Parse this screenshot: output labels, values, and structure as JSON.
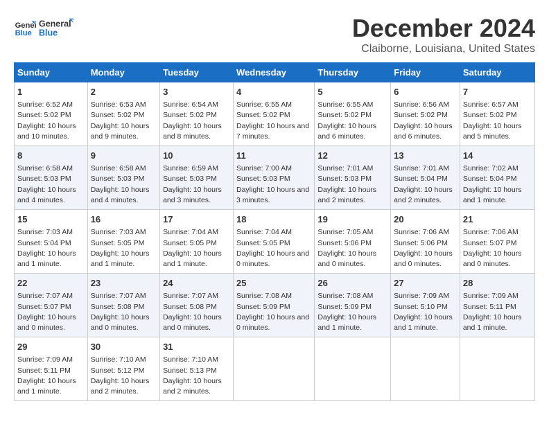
{
  "logo": {
    "line1": "General",
    "line2": "Blue"
  },
  "title": "December 2024",
  "subtitle": "Claiborne, Louisiana, United States",
  "days_of_week": [
    "Sunday",
    "Monday",
    "Tuesday",
    "Wednesday",
    "Thursday",
    "Friday",
    "Saturday"
  ],
  "weeks": [
    [
      {
        "day": "1",
        "info": "Sunrise: 6:52 AM\nSunset: 5:02 PM\nDaylight: 10 hours and 10 minutes."
      },
      {
        "day": "2",
        "info": "Sunrise: 6:53 AM\nSunset: 5:02 PM\nDaylight: 10 hours and 9 minutes."
      },
      {
        "day": "3",
        "info": "Sunrise: 6:54 AM\nSunset: 5:02 PM\nDaylight: 10 hours and 8 minutes."
      },
      {
        "day": "4",
        "info": "Sunrise: 6:55 AM\nSunset: 5:02 PM\nDaylight: 10 hours and 7 minutes."
      },
      {
        "day": "5",
        "info": "Sunrise: 6:55 AM\nSunset: 5:02 PM\nDaylight: 10 hours and 6 minutes."
      },
      {
        "day": "6",
        "info": "Sunrise: 6:56 AM\nSunset: 5:02 PM\nDaylight: 10 hours and 6 minutes."
      },
      {
        "day": "7",
        "info": "Sunrise: 6:57 AM\nSunset: 5:02 PM\nDaylight: 10 hours and 5 minutes."
      }
    ],
    [
      {
        "day": "8",
        "info": "Sunrise: 6:58 AM\nSunset: 5:03 PM\nDaylight: 10 hours and 4 minutes."
      },
      {
        "day": "9",
        "info": "Sunrise: 6:58 AM\nSunset: 5:03 PM\nDaylight: 10 hours and 4 minutes."
      },
      {
        "day": "10",
        "info": "Sunrise: 6:59 AM\nSunset: 5:03 PM\nDaylight: 10 hours and 3 minutes."
      },
      {
        "day": "11",
        "info": "Sunrise: 7:00 AM\nSunset: 5:03 PM\nDaylight: 10 hours and 3 minutes."
      },
      {
        "day": "12",
        "info": "Sunrise: 7:01 AM\nSunset: 5:03 PM\nDaylight: 10 hours and 2 minutes."
      },
      {
        "day": "13",
        "info": "Sunrise: 7:01 AM\nSunset: 5:04 PM\nDaylight: 10 hours and 2 minutes."
      },
      {
        "day": "14",
        "info": "Sunrise: 7:02 AM\nSunset: 5:04 PM\nDaylight: 10 hours and 1 minute."
      }
    ],
    [
      {
        "day": "15",
        "info": "Sunrise: 7:03 AM\nSunset: 5:04 PM\nDaylight: 10 hours and 1 minute."
      },
      {
        "day": "16",
        "info": "Sunrise: 7:03 AM\nSunset: 5:05 PM\nDaylight: 10 hours and 1 minute."
      },
      {
        "day": "17",
        "info": "Sunrise: 7:04 AM\nSunset: 5:05 PM\nDaylight: 10 hours and 1 minute."
      },
      {
        "day": "18",
        "info": "Sunrise: 7:04 AM\nSunset: 5:05 PM\nDaylight: 10 hours and 0 minutes."
      },
      {
        "day": "19",
        "info": "Sunrise: 7:05 AM\nSunset: 5:06 PM\nDaylight: 10 hours and 0 minutes."
      },
      {
        "day": "20",
        "info": "Sunrise: 7:06 AM\nSunset: 5:06 PM\nDaylight: 10 hours and 0 minutes."
      },
      {
        "day": "21",
        "info": "Sunrise: 7:06 AM\nSunset: 5:07 PM\nDaylight: 10 hours and 0 minutes."
      }
    ],
    [
      {
        "day": "22",
        "info": "Sunrise: 7:07 AM\nSunset: 5:07 PM\nDaylight: 10 hours and 0 minutes."
      },
      {
        "day": "23",
        "info": "Sunrise: 7:07 AM\nSunset: 5:08 PM\nDaylight: 10 hours and 0 minutes."
      },
      {
        "day": "24",
        "info": "Sunrise: 7:07 AM\nSunset: 5:08 PM\nDaylight: 10 hours and 0 minutes."
      },
      {
        "day": "25",
        "info": "Sunrise: 7:08 AM\nSunset: 5:09 PM\nDaylight: 10 hours and 0 minutes."
      },
      {
        "day": "26",
        "info": "Sunrise: 7:08 AM\nSunset: 5:09 PM\nDaylight: 10 hours and 1 minute."
      },
      {
        "day": "27",
        "info": "Sunrise: 7:09 AM\nSunset: 5:10 PM\nDaylight: 10 hours and 1 minute."
      },
      {
        "day": "28",
        "info": "Sunrise: 7:09 AM\nSunset: 5:11 PM\nDaylight: 10 hours and 1 minute."
      }
    ],
    [
      {
        "day": "29",
        "info": "Sunrise: 7:09 AM\nSunset: 5:11 PM\nDaylight: 10 hours and 1 minute."
      },
      {
        "day": "30",
        "info": "Sunrise: 7:10 AM\nSunset: 5:12 PM\nDaylight: 10 hours and 2 minutes."
      },
      {
        "day": "31",
        "info": "Sunrise: 7:10 AM\nSunset: 5:13 PM\nDaylight: 10 hours and 2 minutes."
      },
      {
        "day": "",
        "info": ""
      },
      {
        "day": "",
        "info": ""
      },
      {
        "day": "",
        "info": ""
      },
      {
        "day": "",
        "info": ""
      }
    ]
  ]
}
